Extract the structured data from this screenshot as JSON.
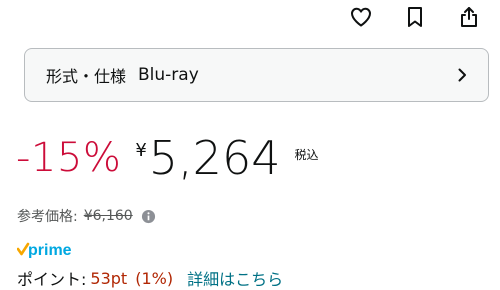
{
  "header": {
    "icons": [
      "heart-icon",
      "bookmark-icon",
      "share-icon"
    ]
  },
  "format": {
    "label": "形式・仕様",
    "value": "Blu-ray"
  },
  "price": {
    "discount": "-15%",
    "currency": "¥",
    "amount": "5,264",
    "tax_note": "税込"
  },
  "reference": {
    "label": "参考価格:",
    "original_price": "¥6,160"
  },
  "prime": {
    "label": "prime",
    "brand_color": "#00a8e1",
    "check_color": "#f7a700"
  },
  "points": {
    "label": "ポイント:",
    "value": "53pt",
    "percent": "(1%)",
    "details_link": "詳細はこちら"
  },
  "colors": {
    "discount": "#cc0c39",
    "points": "#b12704",
    "link": "#007185"
  }
}
